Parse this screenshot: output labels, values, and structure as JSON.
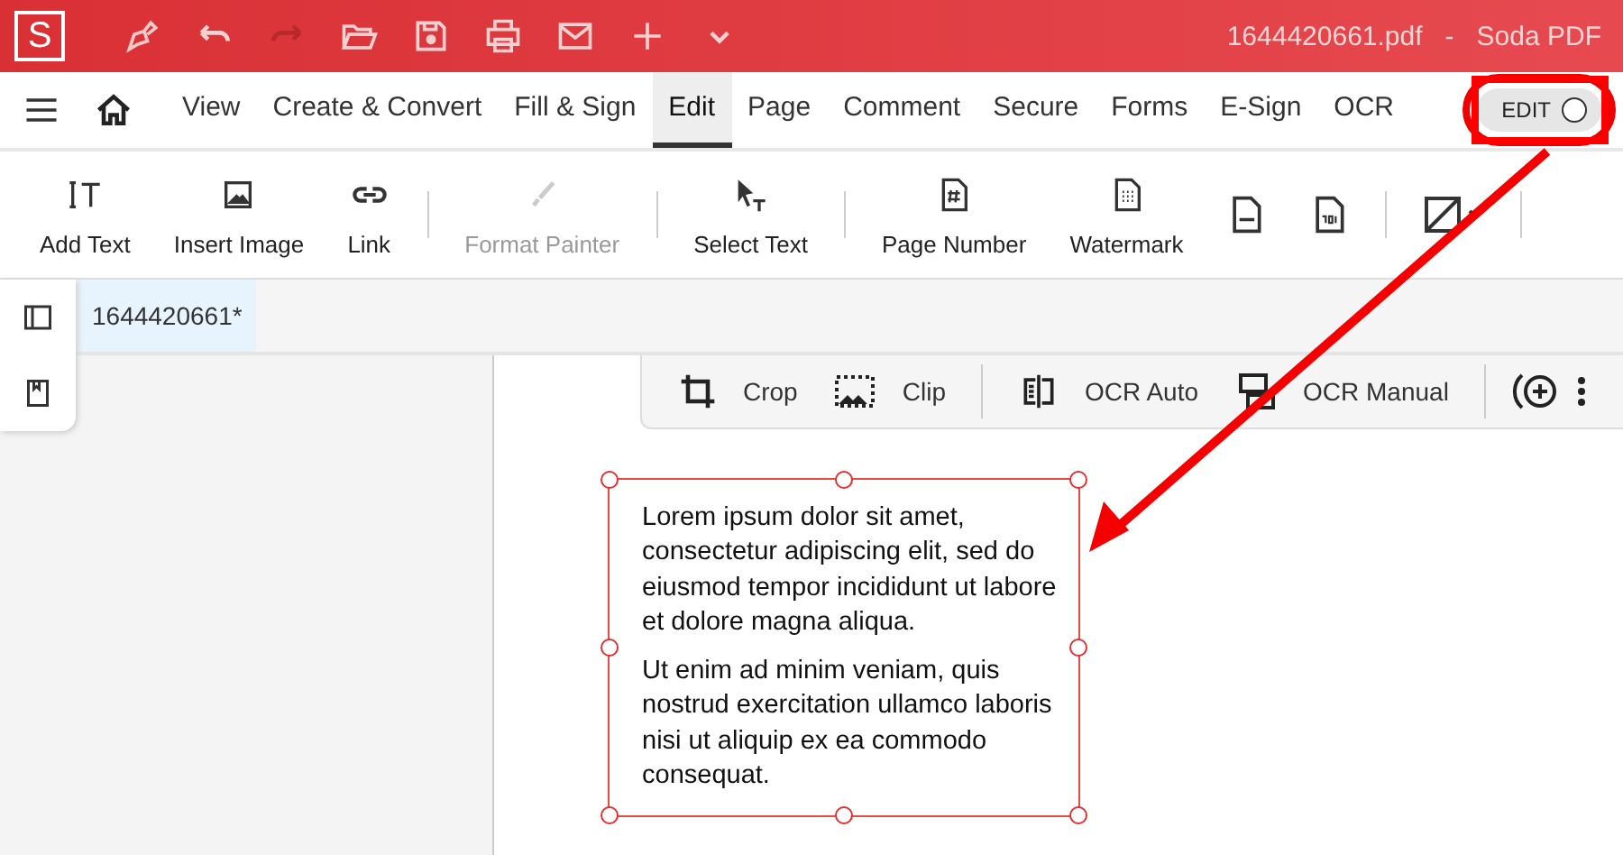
{
  "window": {
    "app_letter": "S",
    "title": "1644420661.pdf   -   Soda PDF"
  },
  "menu_tabs": [
    {
      "label": "View",
      "selected": false
    },
    {
      "label": "Create & Convert",
      "selected": false
    },
    {
      "label": "Fill & Sign",
      "selected": false
    },
    {
      "label": "Edit",
      "selected": true
    },
    {
      "label": "Page",
      "selected": false
    },
    {
      "label": "Comment",
      "selected": false
    },
    {
      "label": "Secure",
      "selected": false
    },
    {
      "label": "Forms",
      "selected": false
    },
    {
      "label": "E-Sign",
      "selected": false
    },
    {
      "label": "OCR",
      "selected": false
    }
  ],
  "edit_toggle": {
    "label": "EDIT",
    "on": false
  },
  "toolbar": [
    {
      "kind": "addtext",
      "label": "Add Text",
      "disabled": false
    },
    {
      "kind": "image",
      "label": "Insert Image",
      "disabled": false
    },
    {
      "kind": "link",
      "label": "Link",
      "disabled": false
    },
    {
      "kind": "painter",
      "label": "Format Painter",
      "disabled": true
    },
    {
      "kind": "select",
      "label": "Select Text",
      "disabled": false
    },
    {
      "kind": "pagenum",
      "label": "Page Number",
      "disabled": false
    },
    {
      "kind": "watermark",
      "label": "Watermark",
      "disabled": false
    }
  ],
  "document_tab": {
    "label": "1644420661*",
    "selected": true
  },
  "float_toolbar": [
    {
      "kind": "crop",
      "label": "Crop"
    },
    {
      "kind": "clip",
      "label": "Clip"
    },
    {
      "kind": "ocrauto",
      "label": "OCR Auto"
    },
    {
      "kind": "ocrmanual",
      "label": "OCR Manual"
    }
  ],
  "text_box": {
    "paragraphs": [
      "Lorem ipsum dolor sit amet, consectetur adipiscing elit, sed do eiusmod tempor incididunt ut labore et dolore magna aliqua.",
      "Ut enim ad minim veniam, quis nostrud exercitation ullamco laboris nisi ut aliquip ex ea commodo consequat."
    ]
  }
}
